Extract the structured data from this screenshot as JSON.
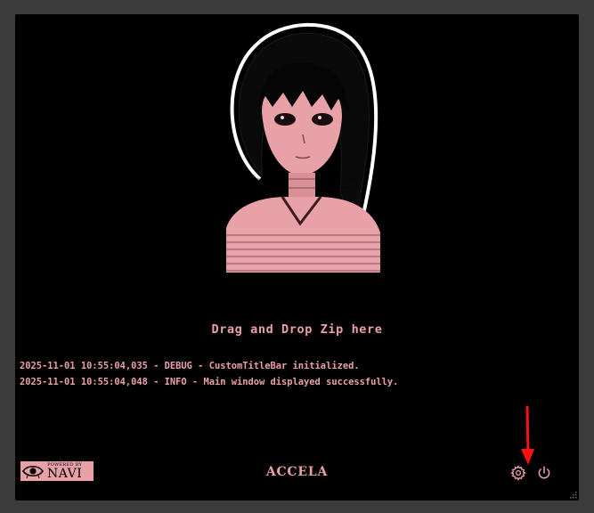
{
  "dropzone": {
    "label": "Drag and Drop Zip here"
  },
  "log": {
    "lines": [
      "2025-11-01 10:55:04,035 - DEBUG - CustomTitleBar initialized.",
      "2025-11-01 10:55:04,048 - INFO - Main window displayed successfully."
    ]
  },
  "footer": {
    "badge_small": "POWERED BY",
    "badge_big": "NAVI",
    "app_title": "ACCELA",
    "settings_icon": "gear-icon",
    "power_icon": "power-icon"
  },
  "colors": {
    "accent": "#e9a1a8",
    "background": "#000000",
    "annotation_arrow": "#ff1010"
  }
}
